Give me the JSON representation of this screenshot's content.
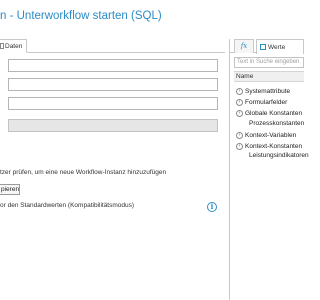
{
  "window": {
    "title": "n - Unterworkflow starten (SQL)"
  },
  "left_panel": {
    "tab_daten_label": "Daten",
    "hint_text": "tzer prüfen, um eine neue Workflow-Instanz hinzuzufügen",
    "copy_button_label": "pieren",
    "standard_values_label": "or den Standardwerten (Kompatibilitätsmodus)"
  },
  "right_panel": {
    "tab_fx_label": "fx",
    "tab_werte_label": "Werte",
    "search_placeholder": "Text in Suche eingeben",
    "column_header": "Name",
    "items": [
      {
        "label": "Systemattribute"
      },
      {
        "label": "Formularfelder"
      },
      {
        "label": "Globale Konstanten"
      },
      {
        "label": "Prozesskonstanten"
      },
      {
        "label": "Kontext-Variablen"
      },
      {
        "label": "Kontext-Konstanten"
      },
      {
        "label": "Leistungsindikatoren"
      }
    ]
  },
  "colors": {
    "accent": "#2b8dc6"
  },
  "icons": [
    "daten-tab-icon",
    "werte-tab-icon",
    "info-icon",
    "expand-arrow-icon"
  ]
}
